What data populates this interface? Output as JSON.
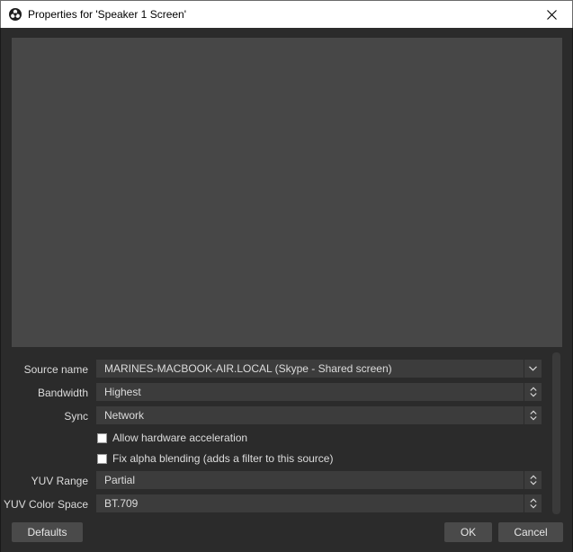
{
  "window": {
    "title": "Properties for 'Speaker 1 Screen'",
    "icon": "obs-logo-icon",
    "close_icon": "close-icon"
  },
  "properties": {
    "source_name": {
      "label": "Source name",
      "value": "MARINES-MACBOOK-AIR.LOCAL (Skype - Shared screen)",
      "icon": "chevron-down-icon"
    },
    "bandwidth": {
      "label": "Bandwidth",
      "value": "Highest",
      "icon": "spin-arrows-icon"
    },
    "sync": {
      "label": "Sync",
      "value": "Network",
      "icon": "spin-arrows-icon"
    },
    "hw_accel": {
      "label": "Allow hardware acceleration",
      "checked": false
    },
    "fix_alpha": {
      "label": "Fix alpha blending (adds a filter to this source)",
      "checked": false
    },
    "yuv_range": {
      "label": "YUV Range",
      "value": "Partial",
      "icon": "spin-arrows-icon"
    },
    "yuv_color_space": {
      "label": "YUV Color Space",
      "value": "BT.709",
      "icon": "spin-arrows-icon"
    }
  },
  "buttons": {
    "defaults": "Defaults",
    "ok": "OK",
    "cancel": "Cancel"
  },
  "colors": {
    "background": "#2b2b2b",
    "preview": "#474747",
    "field": "#3c3c3c",
    "button": "#4a4a4a",
    "text": "#dcdcdc"
  }
}
